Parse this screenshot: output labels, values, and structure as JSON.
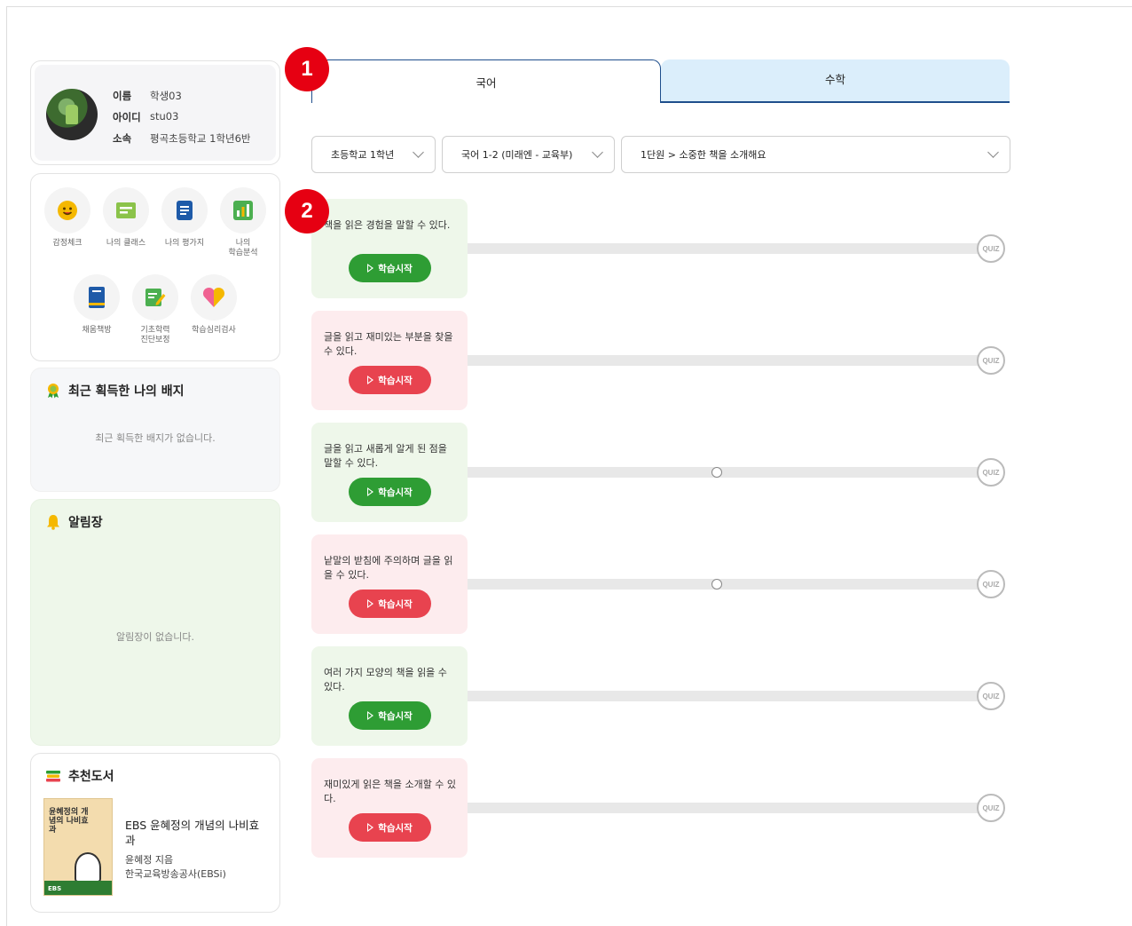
{
  "profile": {
    "name_label": "이름",
    "name_value": "학생03",
    "id_label": "아이디",
    "id_value": "stu03",
    "org_label": "소속",
    "org_value": "평곡초등학교 1학년6반"
  },
  "menu": [
    {
      "label": "감정체크",
      "icon": "smile-icon",
      "color": "#f5b800"
    },
    {
      "label": "나의 클래스",
      "icon": "class-board-icon",
      "color": "#8bc34a"
    },
    {
      "label": "나의 평가지",
      "icon": "document-icon",
      "color": "#1e5aa8"
    },
    {
      "label": "나의\n학습분석",
      "icon": "bar-chart-icon",
      "color": "#4caf50"
    },
    {
      "label": "채움책방",
      "icon": "book-icon",
      "color": "#1e5aa8"
    },
    {
      "label": "기초학력\n진단보정",
      "icon": "note-pencil-icon",
      "color": "#4caf50"
    },
    {
      "label": "학습심리검사",
      "icon": "heart-icon",
      "color": "#f06292"
    }
  ],
  "badges": {
    "title": "최근 획득한 나의 배지",
    "empty": "최근 획득한 배지가 없습니다."
  },
  "notice": {
    "title": "알림장",
    "empty": "알림장이 없습니다."
  },
  "books": {
    "title": "추천도서",
    "item": {
      "cover_text": "윤혜정의 개념의 나비효과",
      "cover_brand": "EBS",
      "title": "EBS 윤혜정의 개념의 나비효과",
      "author": "윤혜정 지음",
      "publisher": "한국교육방송공사(EBSi)"
    }
  },
  "markers": [
    "1",
    "2"
  ],
  "tabs": [
    {
      "label": "국어",
      "active": true
    },
    {
      "label": "수학",
      "active": false
    }
  ],
  "selects": {
    "grade": "초등학교 1학년",
    "textbook": "국어 1-2 (미래엔 - 교육부)",
    "unit": "1단원 > 소중한 책을 소개해요"
  },
  "start_label": "학습시작",
  "quiz_label": "QUIZ",
  "lessons": [
    {
      "text": "책을 읽은 경험을 말할 수 있다.",
      "theme": "green",
      "progress_dot": false
    },
    {
      "text": "글을 읽고 재미있는 부분을 찾을 수 있다.",
      "theme": "pink",
      "progress_dot": false
    },
    {
      "text": "글을 읽고 새롭게 알게 된 점을 말할 수 있다.",
      "theme": "green",
      "progress_dot": true
    },
    {
      "text": "낱말의 받침에 주의하며 글을 읽을 수 있다.",
      "theme": "pink",
      "progress_dot": true
    },
    {
      "text": "여러 가지 모양의 책을 읽을 수 있다.",
      "theme": "green",
      "progress_dot": false
    },
    {
      "text": "재미있게 읽은 책을 소개할 수 있다.",
      "theme": "pink",
      "progress_dot": false
    }
  ]
}
